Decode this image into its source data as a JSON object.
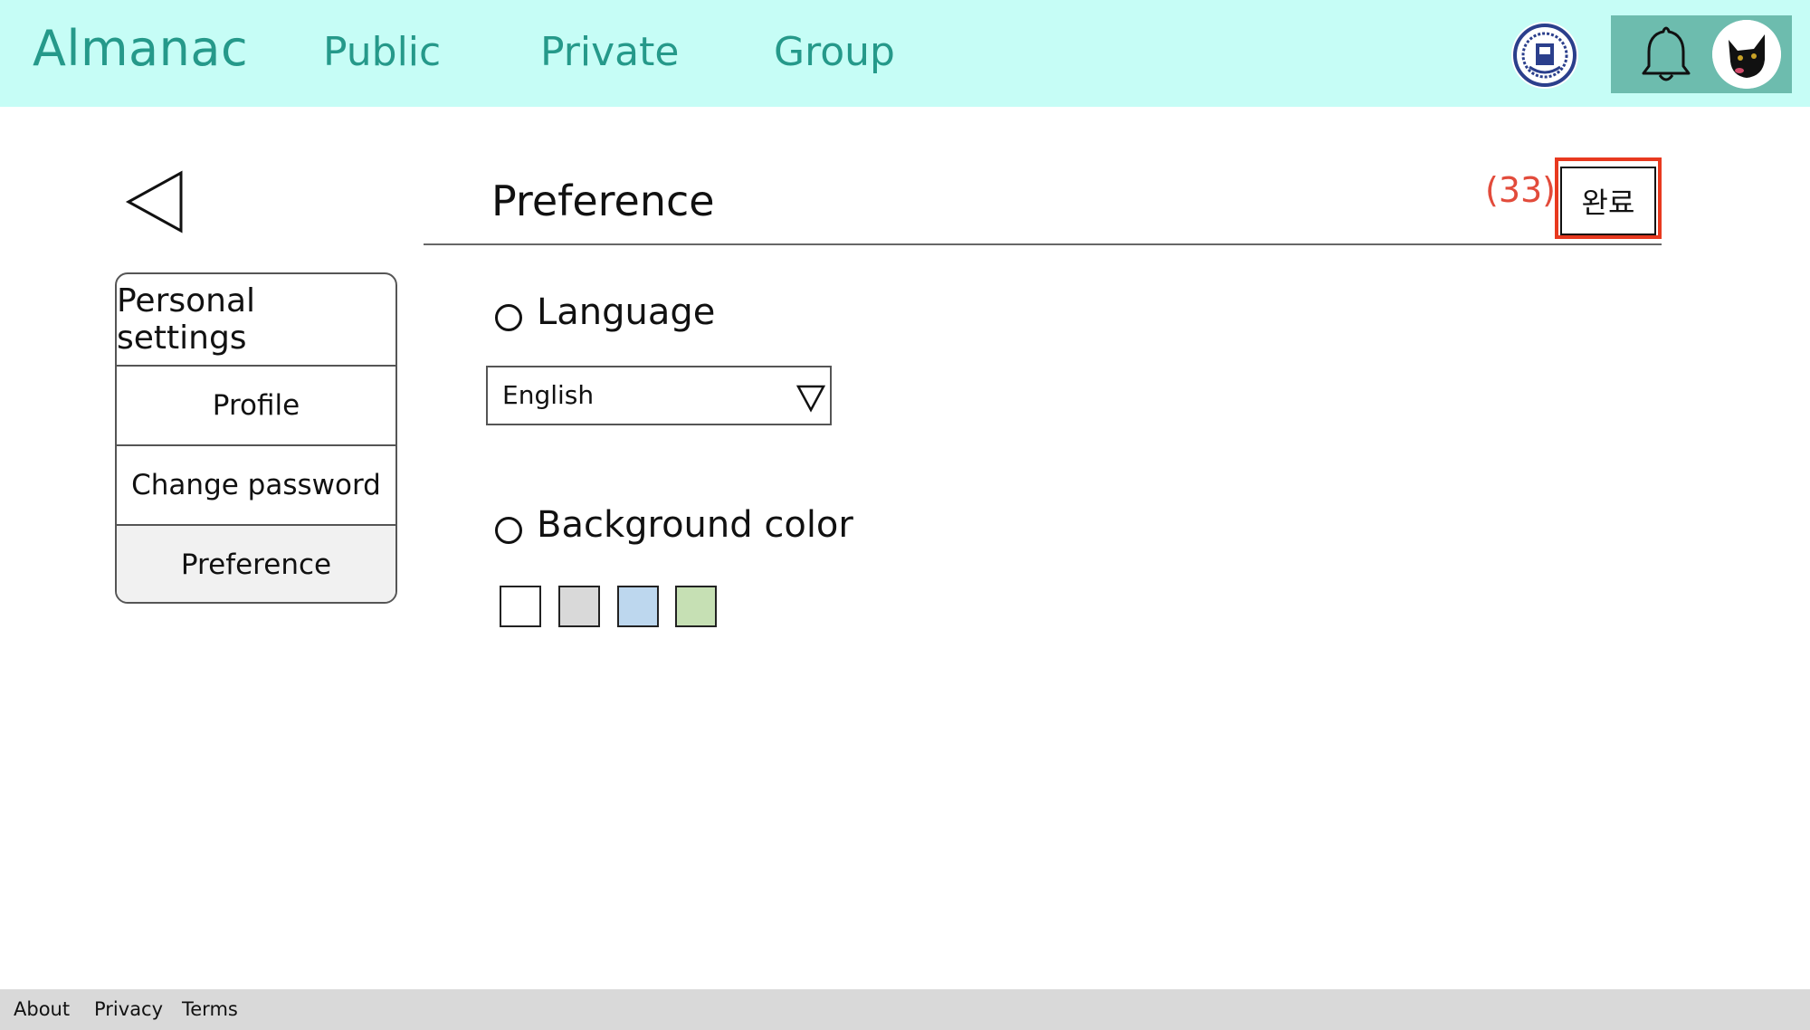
{
  "header": {
    "brand": "Almanac",
    "nav": {
      "public": "Public",
      "private": "Private",
      "group": "Group"
    },
    "icons": {
      "logo": "university-seal-icon",
      "bell": "bell-icon",
      "avatar": "black-cat-avatar"
    },
    "colors": {
      "bar": "#c6fdf6",
      "accent": "#25998a",
      "user_box": "#6dbcae"
    }
  },
  "sidebar": {
    "heading": "Personal settings",
    "items": [
      {
        "label": "Profile"
      },
      {
        "label": "Change password"
      },
      {
        "label": "Preference",
        "active": true
      }
    ]
  },
  "main": {
    "title": "Preference",
    "step_number": "(33)",
    "done_label": "완료",
    "language": {
      "title": "Language",
      "selected": "English"
    },
    "background": {
      "title": "Background color",
      "swatches": [
        "#ffffff",
        "#d9d9d9",
        "#bdd7ee",
        "#c6e0b4"
      ]
    }
  },
  "footer": {
    "links": [
      "About",
      "Privacy",
      "Terms"
    ]
  }
}
